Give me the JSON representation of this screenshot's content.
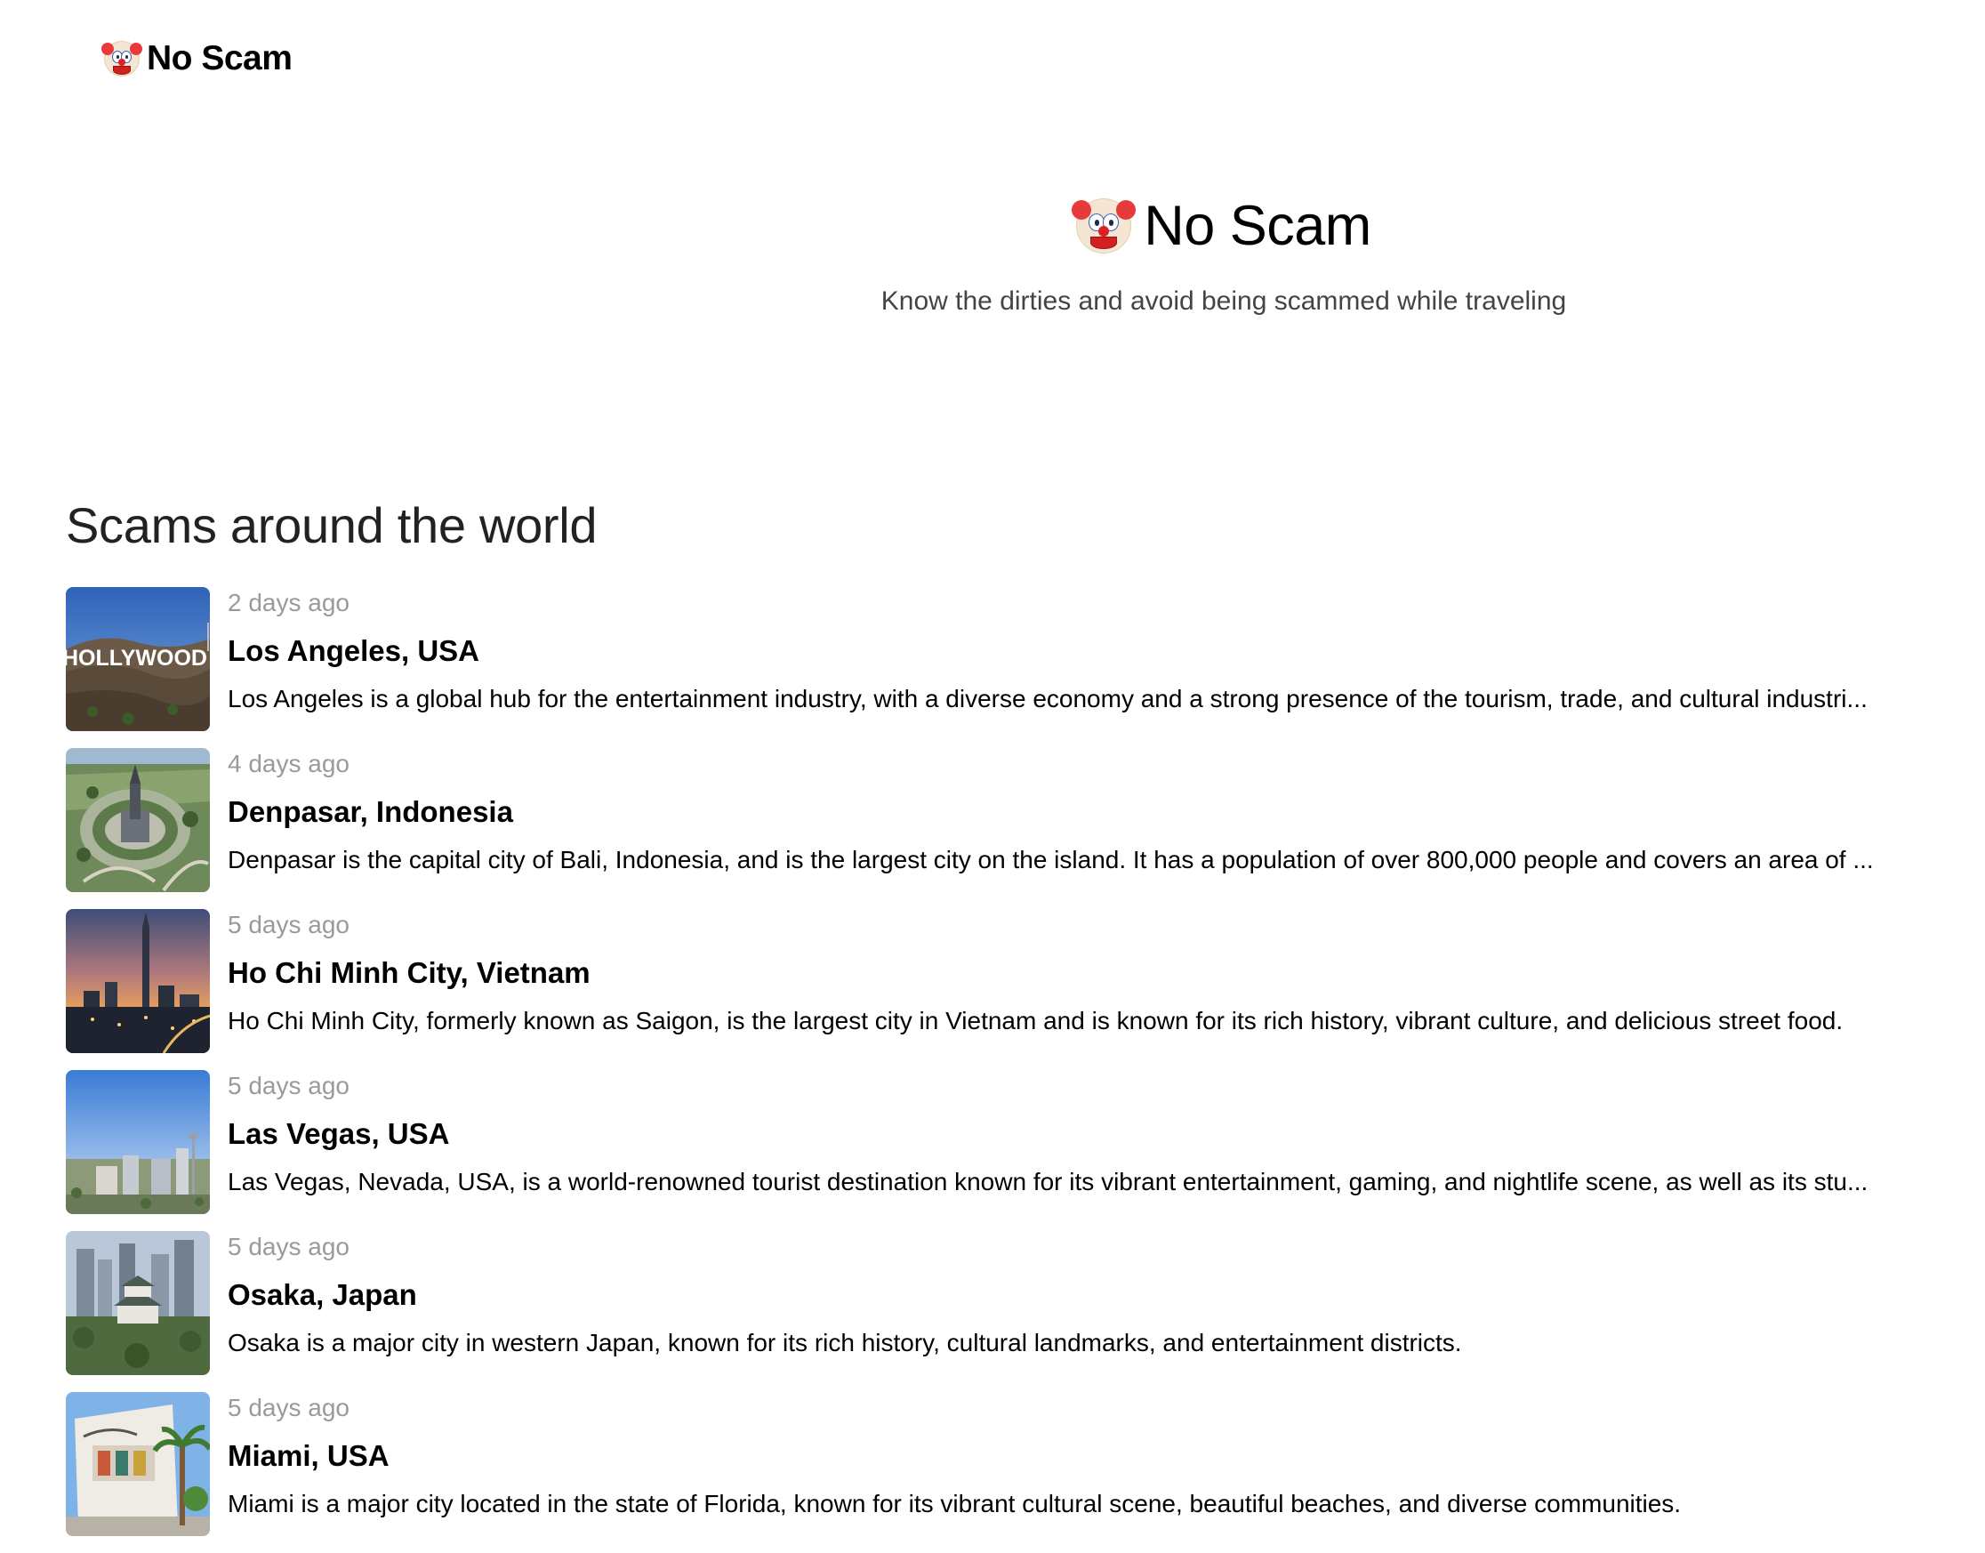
{
  "nav": {
    "brand_icon": "clown-face-icon",
    "brand_label": "No Scam"
  },
  "hero": {
    "icon": "clown-face-icon",
    "title": "No Scam",
    "tagline": "Know the dirties and avoid being scammed while traveling"
  },
  "section": {
    "heading": "Scams around the world"
  },
  "scams": [
    {
      "date": "2 days ago",
      "title": "Los Angeles, USA",
      "description": "Los Angeles is a global hub for the entertainment industry, with a diverse economy and a strong presence of the tourism, trade, and cultural industri...",
      "thumbnail": "hollywood-sign-image",
      "thumbnail_text": "HOLLYWOOD"
    },
    {
      "date": "4 days ago",
      "title": "Denpasar, Indonesia",
      "description": "Denpasar is the capital city of Bali, Indonesia, and is the largest city on the island. It has a population of over 800,000 people and covers an area of ...",
      "thumbnail": "denpasar-monument-aerial-image"
    },
    {
      "date": "5 days ago",
      "title": "Ho Chi Minh City, Vietnam",
      "description": "Ho Chi Minh City, formerly known as Saigon, is the largest city in Vietnam and is known for its rich history, vibrant culture, and delicious street food.",
      "thumbnail": "saigon-skyline-sunset-image"
    },
    {
      "date": "5 days ago",
      "title": "Las Vegas, USA",
      "description": "Las Vegas, Nevada, USA, is a world-renowned tourist destination known for its vibrant entertainment, gaming, and nightlife scene, as well as its stu...",
      "thumbnail": "las-vegas-cityscape-image"
    },
    {
      "date": "5 days ago",
      "title": "Osaka, Japan",
      "description": "Osaka is a major city in western Japan, known for its rich history, cultural landmarks, and entertainment districts.",
      "thumbnail": "osaka-castle-skyline-image"
    },
    {
      "date": "5 days ago",
      "title": "Miami, USA",
      "description": "Miami is a major city located in the state of Florida, known for its vibrant cultural scene, beautiful beaches, and diverse communities.",
      "thumbnail": "miami-building-palms-image"
    }
  ]
}
